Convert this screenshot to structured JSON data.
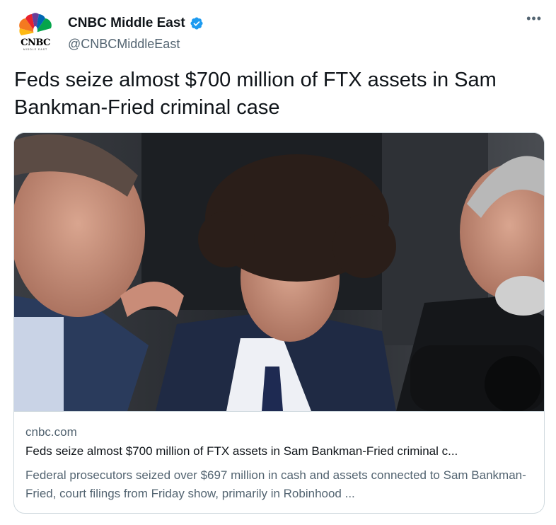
{
  "author": {
    "display_name": "CNBC Middle East",
    "handle": "@CNBCMiddleEast",
    "verified": true,
    "avatar": {
      "wordmark": "CNBC",
      "subtitle": "MIDDLE EAST",
      "icon": "cnbc-peacock-icon"
    }
  },
  "menu": {
    "more_label": "•••",
    "icon": "more-options-icon"
  },
  "tweet": {
    "text": "Feds seize almost $700 million of FTX assets in Sam Bankman-Fried criminal case"
  },
  "card": {
    "image_icon": "news-photo",
    "domain": "cnbc.com",
    "title": "Feds seize almost $700 million of FTX assets in Sam Bankman-Fried criminal c...",
    "description": "Federal prosecutors seized over $697 million in cash and assets connected to Sam Bankman-Fried, court filings from Friday show, primarily in Robinhood ..."
  },
  "colors": {
    "text_primary": "#0f1419",
    "text_secondary": "#536471",
    "verified_blue": "#1d9bf0",
    "border": "#cfd9de"
  }
}
